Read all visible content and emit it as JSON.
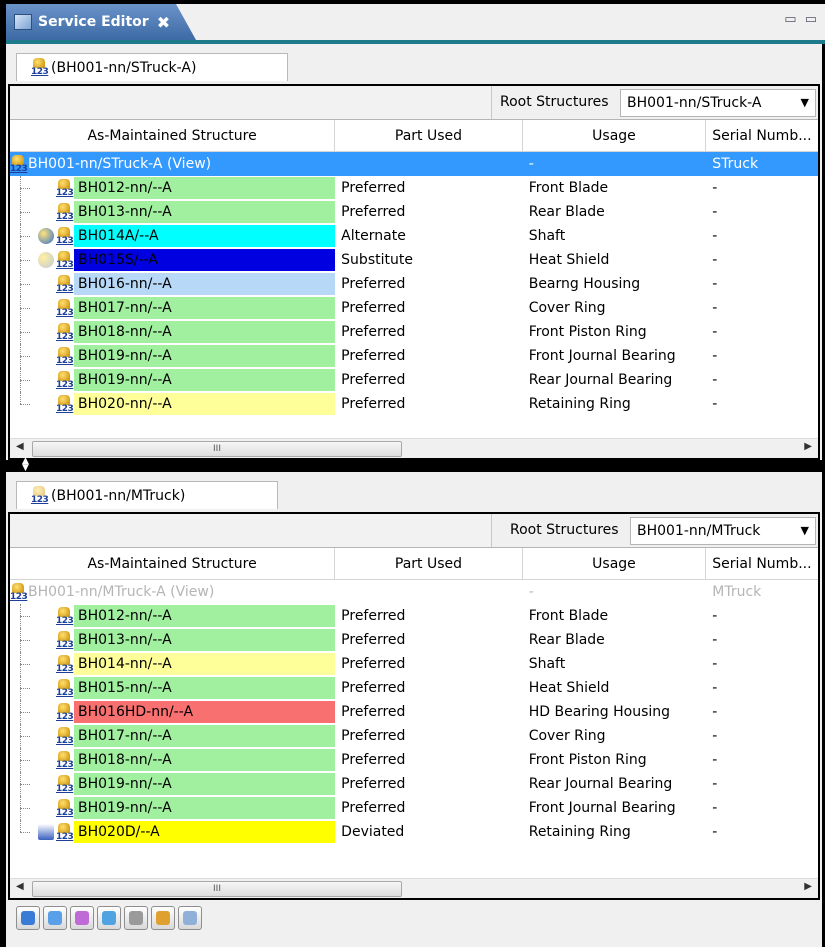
{
  "editor": {
    "tab_title": "Service Editor",
    "close_glyph": "✖"
  },
  "columns": {
    "name": "As-Maintained Structure",
    "part_used": "Part Used",
    "usage": "Usage",
    "serial": "Serial Numb..."
  },
  "root_label": "Root Structures",
  "scroll_thumb": "III",
  "colors": {
    "green": "#a0f0a0",
    "cyan": "#00ffff",
    "blue": "#0000e0",
    "lightblue": "#b8d8f8",
    "lightyellow": "#ffff99",
    "salmon": "#f87070",
    "yellow": "#ffff00",
    "selection": "#3399ff"
  },
  "top": {
    "subtab": "(BH001-nn/STruck-A)",
    "root_value": "BH001-nn/STruck-A",
    "root_row": {
      "name": "BH001-nn/STruck-A (View)",
      "usage": "-",
      "serial": "STruck"
    },
    "rows": [
      {
        "name": "BH012-nn/--A",
        "part_used": "Preferred",
        "usage": "Front Blade",
        "serial": "-",
        "color": "#a0f0a0"
      },
      {
        "name": "BH013-nn/--A",
        "part_used": "Preferred",
        "usage": "Rear Blade",
        "serial": "-",
        "color": "#a0f0a0"
      },
      {
        "name": "BH014A/--A",
        "part_used": "Alternate",
        "usage": "Shaft",
        "serial": "-",
        "color": "#00ffff",
        "extra": "alternate-icon"
      },
      {
        "name": "BH015S/--A",
        "part_used": "Substitute",
        "usage": "Heat Shield",
        "serial": "-",
        "color": "#0000e0",
        "extra": "substitute-icon"
      },
      {
        "name": "BH016-nn/--A",
        "part_used": "Preferred",
        "usage": "Bearng Housing",
        "serial": "-",
        "color": "#b8d8f8"
      },
      {
        "name": "BH017-nn/--A",
        "part_used": "Preferred",
        "usage": "Cover Ring",
        "serial": "-",
        "color": "#a0f0a0"
      },
      {
        "name": "BH018-nn/--A",
        "part_used": "Preferred",
        "usage": "Front Piston Ring",
        "serial": "-",
        "color": "#a0f0a0"
      },
      {
        "name": "BH019-nn/--A",
        "part_used": "Preferred",
        "usage": "Front Journal Bearing",
        "serial": "-",
        "color": "#a0f0a0"
      },
      {
        "name": "BH019-nn/--A",
        "part_used": "Preferred",
        "usage": "Rear Journal Bearing",
        "serial": "-",
        "color": "#a0f0a0"
      },
      {
        "name": "BH020-nn/--A",
        "part_used": "Preferred",
        "usage": "Retaining Ring",
        "serial": "-",
        "color": "#ffff99"
      }
    ]
  },
  "bottom": {
    "subtab": "(BH001-nn/MTruck)",
    "root_value": "BH001-nn/MTruck",
    "root_row": {
      "name": "BH001-nn/MTruck-A (View)",
      "usage": "-",
      "serial": "MTruck"
    },
    "rows": [
      {
        "name": "BH012-nn/--A",
        "part_used": "Preferred",
        "usage": "Front Blade",
        "serial": "-",
        "color": "#a0f0a0"
      },
      {
        "name": "BH013-nn/--A",
        "part_used": "Preferred",
        "usage": "Rear Blade",
        "serial": "-",
        "color": "#a0f0a0"
      },
      {
        "name": "BH014-nn/--A",
        "part_used": "Preferred",
        "usage": "Shaft",
        "serial": "-",
        "color": "#ffff99"
      },
      {
        "name": "BH015-nn/--A",
        "part_used": "Preferred",
        "usage": "Heat Shield",
        "serial": "-",
        "color": "#a0f0a0"
      },
      {
        "name": "BH016HD-nn/--A",
        "part_used": "Preferred",
        "usage": "HD Bearing Housing",
        "serial": "-",
        "color": "#f87070"
      },
      {
        "name": "BH017-nn/--A",
        "part_used": "Preferred",
        "usage": "Cover Ring",
        "serial": "-",
        "color": "#a0f0a0"
      },
      {
        "name": "BH018-nn/--A",
        "part_used": "Preferred",
        "usage": "Front Piston Ring",
        "serial": "-",
        "color": "#a0f0a0"
      },
      {
        "name": "BH019-nn/--A",
        "part_used": "Preferred",
        "usage": "Rear Journal Bearing",
        "serial": "-",
        "color": "#a0f0a0"
      },
      {
        "name": "BH019-nn/--A",
        "part_used": "Preferred",
        "usage": "Front Journal Bearing",
        "serial": "-",
        "color": "#a0f0a0"
      },
      {
        "name": "BH020D/--A",
        "part_used": "Deviated",
        "usage": "Retaining Ring",
        "serial": "-",
        "color": "#ffff00",
        "extra": "deviation-icon"
      }
    ]
  },
  "toolbar": {
    "buttons": [
      "navigate-icon",
      "new-document-icon",
      "image-icon",
      "refresh-icon",
      "copy-icon",
      "part-icon",
      "search-icon"
    ]
  }
}
